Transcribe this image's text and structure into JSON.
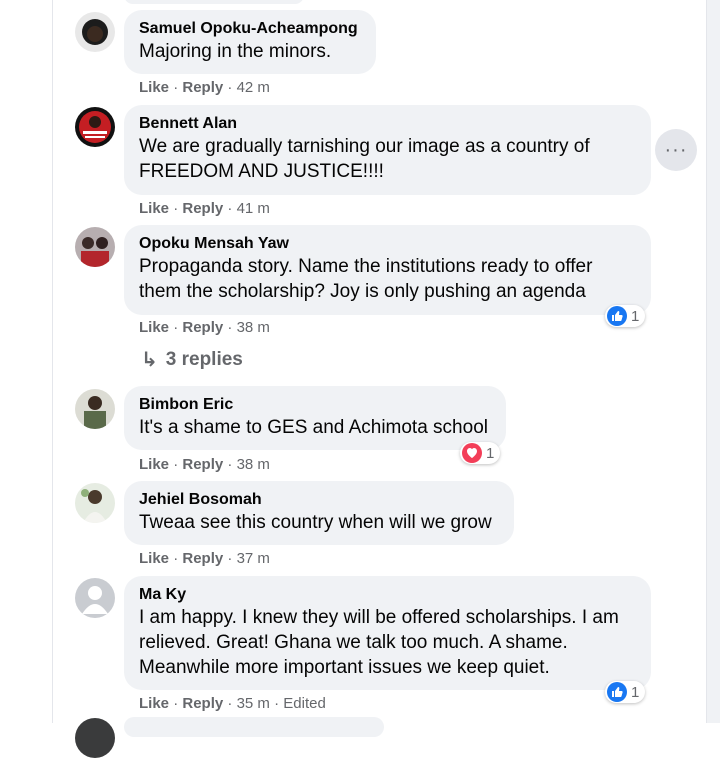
{
  "comments": [
    {
      "author": "Samuel Opoku-Acheampong",
      "text": "Majoring in the minors.",
      "like": "Like",
      "reply": "Reply",
      "time": "42 m",
      "edited": "",
      "avatar_color": "#111111"
    },
    {
      "author": "Bennett Alan",
      "text": "We are gradually tarnishing our image as a country of FREEDOM AND JUSTICE!!!!",
      "like": "Like",
      "reply": "Reply",
      "time": "41 m",
      "edited": "",
      "avatar_color": "#c41e23"
    },
    {
      "author": "Opoku Mensah Yaw",
      "text": "Propaganda story. Name the institutions ready to offer them the scholarship? Joy is only pushing an agenda",
      "like": "Like",
      "reply": "Reply",
      "time": "38 m",
      "edited": "",
      "reaction_count": "1",
      "reaction_icon": "like-icon",
      "avatar_color": "#7a6a6a"
    },
    {
      "author": "Bimbon Eric",
      "text": "It's a shame to GES and Achimota school",
      "like": "Like",
      "reply": "Reply",
      "time": "38 m",
      "edited": "",
      "reaction_count": "1",
      "reaction_icon": "love-icon",
      "avatar_color": "#8a8a7a"
    },
    {
      "author": "Jehiel Bosomah",
      "text": "Tweaa see this country when will we grow",
      "like": "Like",
      "reply": "Reply",
      "time": "37 m",
      "edited": "",
      "avatar_color": "#a9b8a0"
    },
    {
      "author": "Ma Ky",
      "text": "I am happy. I knew they will be offered scholarships. I am relieved. Great! Ghana we talk too much. A shame. Meanwhile more important issues we keep quiet.",
      "like": "Like",
      "reply": "Reply",
      "time": "35 m",
      "edited": "Edited",
      "reaction_count": "1",
      "reaction_icon": "like-icon",
      "avatar_color": "#c9ccd1"
    }
  ],
  "replies": {
    "label": "3 replies",
    "icon": "reply-arrow-icon"
  },
  "more_options": {
    "icon": "more-horizontal-icon",
    "label": "···"
  },
  "colors": {
    "bubble": "#f0f2f5",
    "meta_text": "#65676b",
    "like_blue": "#1877f2",
    "love_red": "#f33e58"
  }
}
